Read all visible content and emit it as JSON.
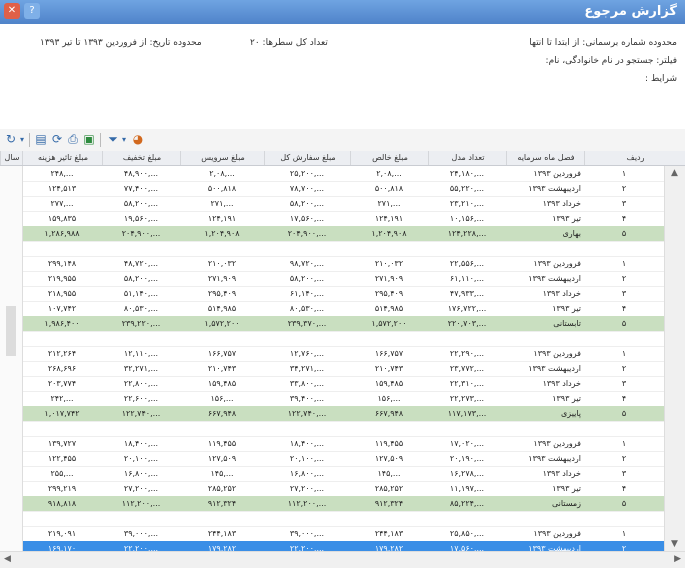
{
  "window": {
    "title": "گزارش مرجوع",
    "close_glyph": "✕",
    "help_glyph": "?"
  },
  "info": {
    "line1": "محدوده شماره برسمانی: از ابتدا تا انتها",
    "line2": "فیلتر: جستجو در نام خانوادگی، نام:",
    "line3": "شرایط :",
    "count": "تعداد کل سطرها: ۲۰",
    "date_range": "محدوده تاریخ: از فروردین ۱۳۹۳ تا تیر ۱۳۹۳"
  },
  "toolbar": {
    "icons": [
      "refresh-icon",
      "chevron-down-icon",
      "document-icon",
      "refresh-alt-icon",
      "printer-icon",
      "export-icon",
      "filter-icon",
      "chevron-down-icon",
      "chart-icon"
    ]
  },
  "columns": [
    "ردیف",
    "فصل ماه سرمایه",
    "تعداد مدل",
    "مبلغ خالص",
    "مبلغ سفارش کل",
    "مبلغ سرویس",
    "مبلغ تخفیف",
    "مبلغ تاثیر هزینه",
    "سال"
  ],
  "rows": [
    {
      "type": "data",
      "cells": [
        "۱",
        "فروردین ۱۳۹۳",
        "۲۴,۱۸۰,...",
        "۲,۰۸,...",
        "۲۵,۲۰۰,...",
        "۲,۰۸,...",
        "۴۸,۹۰۰,...",
        "۲۴۸,...",
        "..."
      ]
    },
    {
      "type": "data",
      "cells": [
        "۲",
        "اردیبهشت ۱۳۹۳",
        "۵۵,۲۲۰,...",
        "۵۰۰,۸۱۸",
        "۷۸,۷۰۰,...",
        "۵۰۰,۸۱۸",
        "۷۷,۴۰۰,...",
        "۱۲۴,۵۱۳",
        "۳۵۵"
      ]
    },
    {
      "type": "data",
      "cells": [
        "۳",
        "خرداد ۱۳۹۳",
        "۲۳,۲۱۰,...",
        "۲۷۱,...",
        "۵۸,۲۰۰,...",
        "۲۷۱,...",
        "۵۸,۲۰۰,...",
        "۲۷۷,...",
        "..."
      ]
    },
    {
      "type": "data",
      "cells": [
        "۴",
        "تیر ۱۳۹۳",
        "۱۰,۱۵۶,...",
        "۱۲۴,۱۹۱",
        "۱۷,۵۶۰,...",
        "۱۲۴,۱۹۱",
        "۱۹,۵۶۰,...",
        "۱۵۹,۸۳۵",
        "۱۷۲"
      ]
    },
    {
      "type": "total",
      "cells": [
        "۵",
        "بهاری",
        "۱۲۴,۲۲۸,...",
        "۱,۲۰۴,۹۰۸",
        "۲۰۴,۹۰۰,...",
        "۱,۲۰۴,۹۰۸",
        "۲۰۴,۹۰۰,...",
        "۱,۲۸۶,۹۸۸",
        "۸۶۷"
      ]
    },
    {
      "type": "blank",
      "cells": [
        "",
        "",
        "",
        "",
        "",
        "",
        "",
        "",
        ""
      ]
    },
    {
      "type": "data",
      "cells": [
        "۱",
        "فروردین ۱۳۹۳",
        "۲۲,۵۵۶,...",
        "۲۱۰,۰۳۲",
        "۹۸,۷۲۰,...",
        "۲۱۰,۰۳۲",
        "۴۸,۷۲۰,...",
        "۲۹۹,۱۴۸",
        "۹۰۹"
      ]
    },
    {
      "type": "data",
      "cells": [
        "۲",
        "اردیبهشت ۱۳۹۳",
        "۶۱,۱۱۰,...",
        "۲۷۱,۹۰۹",
        "۵۸,۲۰۰,...",
        "۲۷۱,۹۰۹",
        "۵۸,۲۰۰,...",
        "۲۱۹,۹۵۵",
        "۷۴۷"
      ]
    },
    {
      "type": "data",
      "cells": [
        "۳",
        "خرداد ۱۳۹۳",
        "۴۷,۹۳۳,...",
        "۲۹۵,۴۰۹",
        "۶۱,۱۴۰,...",
        "۲۹۵,۴۰۹",
        "۵۱,۱۴۰,...",
        "۲۱۸,۹۵۵",
        "۷۴۷"
      ]
    },
    {
      "type": "data",
      "cells": [
        "۴",
        "تیر ۱۳۹۳",
        "۱۷۶,۷۲۲,...",
        "۵۱۴,۹۸۵",
        "۸۰,۵۳۰,...",
        "۵۱۴,۹۸۵",
        "۸۰,۵۳۰,...",
        "۱۰۷,۷۴۲",
        "۳۴۷"
      ]
    },
    {
      "type": "total",
      "cells": [
        "۵",
        "تابستانی",
        "۲۲۰,۷۰۳,...",
        "۱,۵۷۲,۲۰۰",
        "۲۳۹,۳۷۰,...",
        "۱,۵۷۲,۲۰۰",
        "۲۳۹,۲۲۰,...",
        "۱,۹۸۶,۴۰۰",
        "..."
      ]
    },
    {
      "type": "blank",
      "cells": [
        "",
        "",
        "",
        "",
        "",
        "",
        "",
        "",
        ""
      ]
    },
    {
      "type": "data",
      "cells": [
        "۱",
        "فروردین ۱۳۹۳",
        "۲۲,۲۹۰,...",
        "۱۶۶,۷۵۷",
        "۱۲,۷۶۰,...",
        "۱۶۶,۷۵۷",
        "۱۲,۱۱۰,...",
        "۲۱۲,۲۶۴",
        "۱۸۲"
      ]
    },
    {
      "type": "data",
      "cells": [
        "۲",
        "اردیبهشت ۱۳۹۳",
        "۲۳,۷۷۲,...",
        "۲۱۰,۷۴۳",
        "۳۴,۲۷۱,...",
        "۲۱۰,۷۴۳",
        "۳۲,۲۷۱,...",
        "۲۶۸,۶۹۶",
        "۷۸۱"
      ]
    },
    {
      "type": "data",
      "cells": [
        "۳",
        "خرداد ۱۳۹۳",
        "۲۲,۳۱۰,...",
        "۱۵۹,۴۸۵",
        "۳۳,۸۰۰,...",
        "۱۵۹,۴۸۵",
        "۲۲,۸۰۰,...",
        "۲۰۳,۷۷۴",
        "۲۷۲"
      ]
    },
    {
      "type": "data",
      "cells": [
        "۴",
        "تیر ۱۳۹۳",
        "۲۲,۲۷۳,...",
        "۱۵۶,...",
        "۳۹,۴۰۰,...",
        "۱۵۶,...",
        "۲۲,۶۰۰,...",
        "۲۴۲,...",
        "..."
      ]
    },
    {
      "type": "total",
      "cells": [
        "۵",
        "پاییزی",
        "۱۱۷,۱۷۳,...",
        "۶۶۷,۹۴۸",
        "۱۲۲,۷۴۰,...",
        "۶۶۷,۹۴۸",
        "۱۲۲,۷۴۰,...",
        "۱,۰۱۷,۷۴۲",
        "۲۶۲"
      ]
    },
    {
      "type": "blank",
      "cells": [
        "",
        "",
        "",
        "",
        "",
        "",
        "",
        "",
        ""
      ]
    },
    {
      "type": "data",
      "cells": [
        "۱",
        "فروردین ۱۳۹۳",
        "۱۷,۰۲۰,...",
        "۱۱۹,۴۵۵",
        "۱۸,۴۰۰,...",
        "۱۱۹,۴۵۵",
        "۱۸,۴۰۰,...",
        "۱۳۹,۷۲۷",
        "۲۹۲"
      ]
    },
    {
      "type": "data",
      "cells": [
        "۲",
        "اردیبهشت ۱۳۹۳",
        "۲۰,۱۹۰,...",
        "۱۲۷,۵۰۹",
        "۲۰,۱۰۰,...",
        "۱۲۷,۵۰۹",
        "۲۰,۱۰۰,...",
        "۱۲۲,۴۵۵",
        "۷۶۲"
      ]
    },
    {
      "type": "data",
      "cells": [
        "۳",
        "خرداد ۱۳۹۳",
        "۱۶,۲۷۸,...",
        "۱۴۵,...",
        "۱۶,۸۰۰,...",
        "۱۴۵,...",
        "۱۶,۸۰۰,...",
        "۲۵۵,...",
        "..."
      ]
    },
    {
      "type": "data",
      "cells": [
        "۴",
        "تیر ۱۳۹۳",
        "۱۱,۱۹۷,...",
        "۲۸۵,۲۵۲",
        "۲۷,۲۰۰,...",
        "۲۸۵,۲۵۲",
        "۲۷,۲۰۰,...",
        "۲۹۹,۲۱۹",
        "۸۱۵"
      ]
    },
    {
      "type": "total",
      "cells": [
        "۵",
        "زمستانی",
        "۸۵,۲۲۴,...",
        "۹۱۲,۳۲۴",
        "۱۱۲,۲۰۰,...",
        "۹۱۲,۳۲۴",
        "۱۱۲,۲۰۰,...",
        "۹۱۸,۸۱۸",
        "۸۰۸"
      ]
    },
    {
      "type": "blank",
      "cells": [
        "",
        "",
        "",
        "",
        "",
        "",
        "",
        "",
        ""
      ]
    },
    {
      "type": "data",
      "cells": [
        "۱",
        "فروردین ۱۳۹۳",
        "۲۵,۸۵۰,...",
        "۲۴۴,۱۸۳",
        "۳۹,۰۰۰,...",
        "۲۴۴,۱۸۳",
        "۳۹,۰۰۰,...",
        "۲۱۹,۰۹۱",
        "۵۶۵"
      ]
    },
    {
      "type": "selected",
      "cells": [
        "۲",
        "اردیبهشت ۱۳۹۳",
        "۱۷,۵۶۰,...",
        "۱۷۹,۲۸۲",
        "۲۲,۲۰۰,...",
        "۱۷۹,۲۸۲",
        "۲۲,۲۰۰,...",
        "۱۶۹,۱۷۰",
        "۴۹۰"
      ]
    }
  ]
}
